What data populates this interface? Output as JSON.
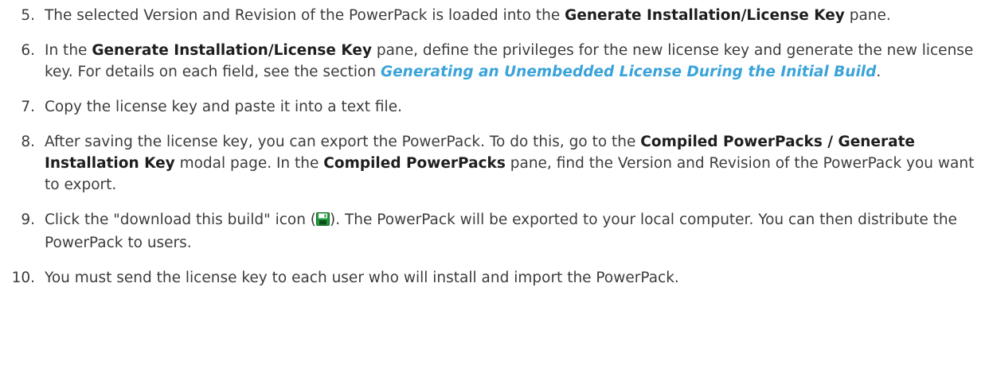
{
  "steps": [
    {
      "number": "5.",
      "t1": "The selected Version and Revision of the PowerPack is loaded into the ",
      "b1": "Generate Installation/License Key",
      "t2": " pane."
    },
    {
      "number": "6.",
      "t1": "In the ",
      "b1": "Generate Installation/License Key",
      "t2": " pane, define the privileges for the new license key and generate the new license key. For details on each field, see the section ",
      "link": "Generating an Unembedded License During the Initial Build",
      "t3": "."
    },
    {
      "number": "7.",
      "t1": "Copy the license key and paste it into a text file."
    },
    {
      "number": "8.",
      "t1": "After saving the license key, you can export the PowerPack. To do this, go to the ",
      "b1": "Compiled PowerPacks / Generate Installation Key",
      "t2": " modal page. In the ",
      "b2": "Compiled PowerPacks",
      "t3": " pane, find the Version and Revision of the PowerPack you want to export."
    },
    {
      "number": "9.",
      "t1": "Click the \"download this build\" icon (",
      "icon": "save-disk-icon",
      "t2": "). The PowerPack will be exported to your local computer. You can then distribute the PowerPack to users."
    },
    {
      "number": "10.",
      "t1": "You must send the license key to each user who will install and import the PowerPack."
    }
  ],
  "colors": {
    "text": "#3c3c3c",
    "bold": "#1e1e1e",
    "link": "#3aa3d9",
    "icon_body": "#1f9a3a",
    "icon_label": "#ffffff"
  }
}
